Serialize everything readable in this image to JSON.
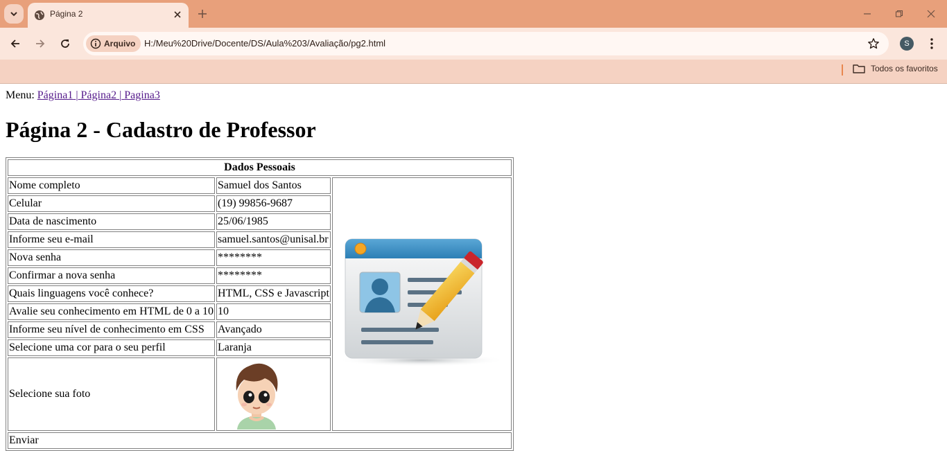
{
  "browser": {
    "tab_title": "Página 2",
    "site_chip_label": "Arquivo",
    "url": "H:/Meu%20Drive/Docente/DS/Aula%203/Avaliação/pg2.html",
    "profile_initial": "S",
    "bookmarks_folder_label": "Todos os favoritos",
    "accent_color": "#e8a07b"
  },
  "page": {
    "menu_label": "Menu:",
    "menu_links": [
      "Página1",
      "Página2",
      "Pagina3"
    ],
    "menu_separator": "|",
    "title": "Página 2 - Cadastro de Professor"
  },
  "form_table": {
    "header": "Dados Pessoais",
    "rows": [
      {
        "label": "Nome completo",
        "value": "Samuel dos Santos"
      },
      {
        "label": "Celular",
        "value": "(19) 99856-9687"
      },
      {
        "label": "Data de nascimento",
        "value": "25/06/1985"
      },
      {
        "label": "Informe seu e-mail",
        "value": "samuel.santos@unisal.br"
      },
      {
        "label": "Nova senha",
        "value": "********"
      },
      {
        "label": "Confirmar a nova senha",
        "value": "********"
      },
      {
        "label": "Quais linguagens você conhece?",
        "value": "HTML, CSS e Javascript"
      },
      {
        "label": "Avalie seu conhecimento em HTML de 0 a 10",
        "value": "10"
      },
      {
        "label": "Informe seu nível de conhecimento em CSS",
        "value": "Avançado"
      },
      {
        "label": "Selecione uma cor para o seu perfil",
        "value": "Laranja"
      },
      {
        "label": "Selecione sua foto",
        "value": ""
      }
    ],
    "footer": "Enviar"
  }
}
